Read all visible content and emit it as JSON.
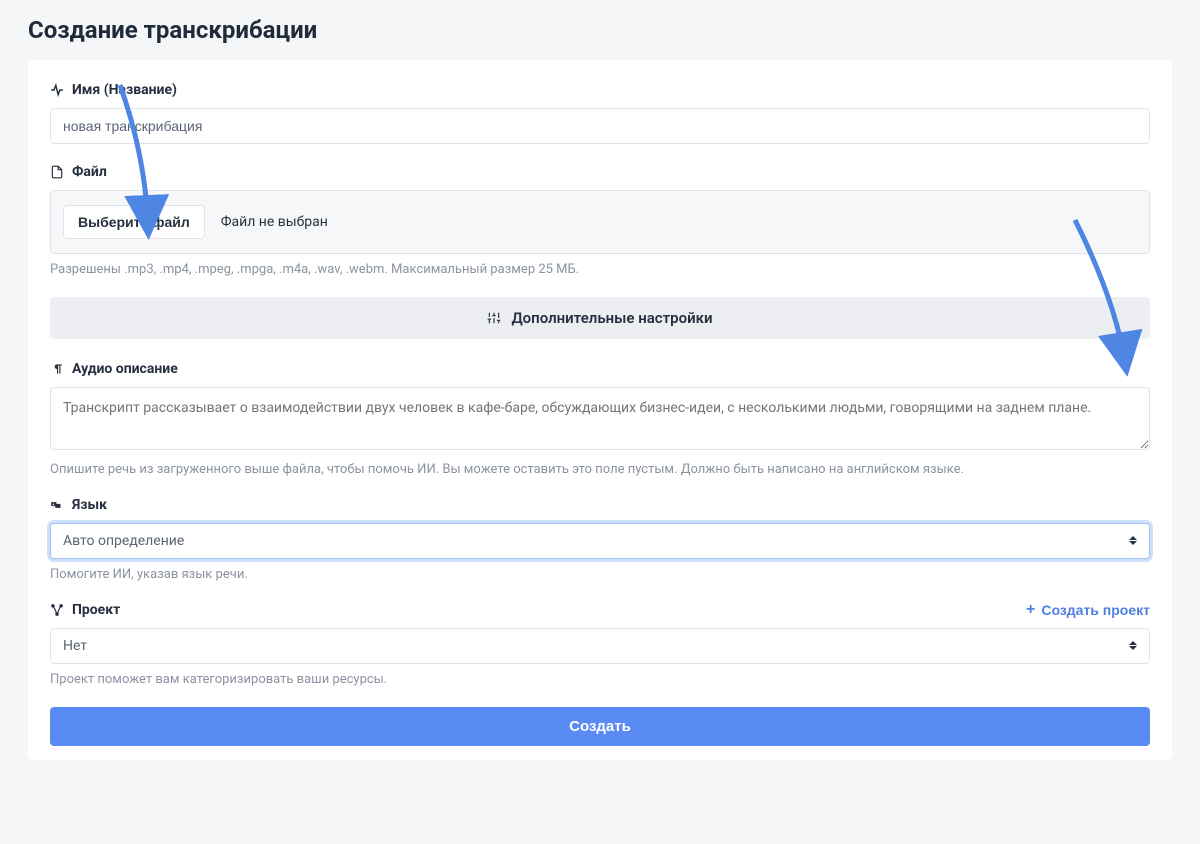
{
  "page": {
    "title": "Создание транскрибации"
  },
  "form": {
    "name": {
      "label": "Имя (Название)",
      "value": "новая транскрибация"
    },
    "file": {
      "label": "Файл",
      "choose_button": "Выберите файл",
      "status": "Файл не выбран",
      "hint": "Разрешены .mp3, .mp4, .mpeg, .mpga, .m4a, .wav, .webm. Максимальный размер 25 МБ."
    },
    "advanced_settings_label": "Дополнительные настройки",
    "description": {
      "label": "Аудио описание",
      "placeholder": "Транскрипт рассказывает о взаимодействии двух человек в кафе-баре, обсуждающих бизнес-идеи, с несколькими людьми, говорящими на заднем плане.",
      "hint": "Опишите речь из загруженного выше файла, чтобы помочь ИИ. Вы можете оставить это поле пустым. Должно быть написано на английском языке."
    },
    "language": {
      "label": "Язык",
      "value": "Авто определение",
      "hint": "Помогите ИИ, указав язык речи."
    },
    "project": {
      "label": "Проект",
      "create_link": "Создать проект",
      "value": "Нет",
      "hint": "Проект поможет вам категоризировать ваши ресурсы."
    },
    "submit_label": "Создать"
  },
  "colors": {
    "accent": "#5a8af4",
    "link": "#4f7fe0",
    "arrow": "#4f85e3"
  }
}
